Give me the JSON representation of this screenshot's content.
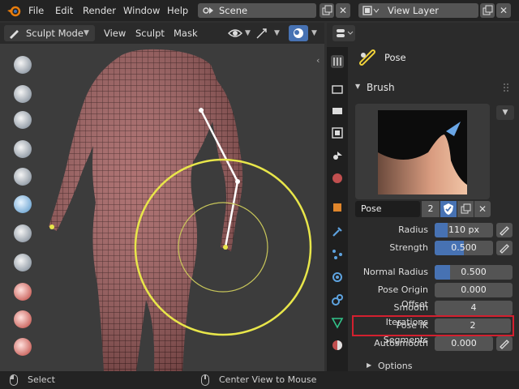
{
  "menu": [
    "File",
    "Edit",
    "Render",
    "Window",
    "Help"
  ],
  "scene": {
    "label": "Scene"
  },
  "view_layer": {
    "label": "View Layer"
  },
  "viewport_header": {
    "mode": "Sculpt Mode",
    "view": "View",
    "sculpt": "Sculpt",
    "mask": "Mask"
  },
  "properties": {
    "tool_name": "Pose",
    "panel_brush": "Brush",
    "brush_name": "Pose",
    "user_count": "2",
    "rows": [
      {
        "label": "Radius",
        "value": "110 px",
        "fill": 0.22
      },
      {
        "label": "Strength",
        "value": "0.500",
        "fill": 0.5
      },
      {
        "label": "Normal Radius",
        "value": "0.500",
        "fill": 0.2
      },
      {
        "label": "Pose Origin Offset",
        "value": "0.000",
        "fill": 0
      },
      {
        "label": "Smooth Iterations",
        "value": "4",
        "fill": 0
      },
      {
        "label": "Pose IK Segments",
        "value": "2",
        "fill": 0
      },
      {
        "label": "Autosmooth",
        "value": "0.000",
        "fill": 0
      }
    ],
    "options": "Options"
  },
  "status": {
    "select": "Select",
    "center": "Center View to Mouse"
  },
  "colors": {
    "accent": "#4772b3",
    "highlight": "#d3202f",
    "skin": "#a05a5a",
    "cursor": "#e8e64a"
  },
  "icons": [
    "blender-logo-icon",
    "scene-icon",
    "copy-icon",
    "close-icon",
    "view-layer-icon",
    "sculpt-mode-icon",
    "eye-icon",
    "gizmo-icon",
    "overlay-icon",
    "tool-icon",
    "render-icon",
    "output-icon",
    "view-layer-props-icon",
    "scene-props-icon",
    "world-icon",
    "object-icon",
    "modifier-icon",
    "particles-icon",
    "physics-icon",
    "constraints-icon",
    "data-icon",
    "material-icon"
  ]
}
